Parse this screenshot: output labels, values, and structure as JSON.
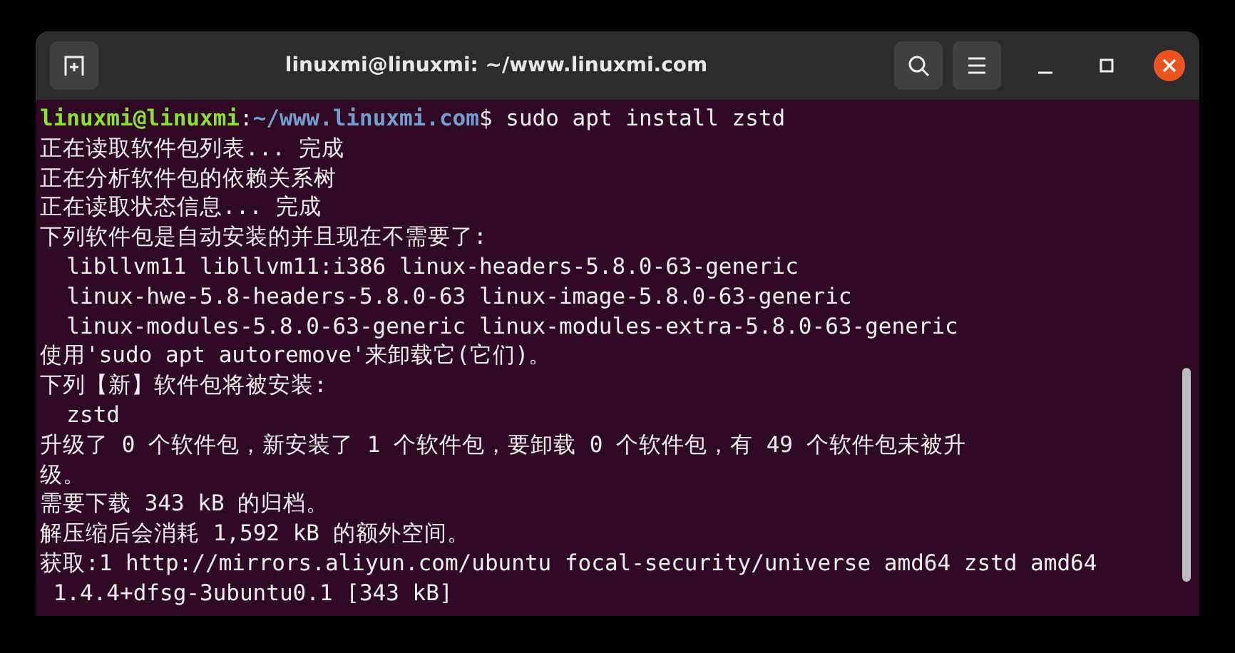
{
  "window": {
    "title": "linuxmi@linuxmi: ~/www.linuxmi.com"
  },
  "prompt": {
    "user_host": "linuxmi@linuxmi",
    "separator": ":",
    "path": "~/www.linuxmi.com",
    "command": "$ sudo apt install zstd"
  },
  "output": [
    "正在读取软件包列表... 完成",
    "正在分析软件包的依赖关系树",
    "正在读取状态信息... 完成",
    "下列软件包是自动安装的并且现在不需要了:",
    "  libllvm11 libllvm11:i386 linux-headers-5.8.0-63-generic",
    "  linux-hwe-5.8-headers-5.8.0-63 linux-image-5.8.0-63-generic",
    "  linux-modules-5.8.0-63-generic linux-modules-extra-5.8.0-63-generic",
    "使用'sudo apt autoremove'来卸载它(它们)。",
    "下列【新】软件包将被安装:",
    "  zstd",
    "升级了 0 个软件包，新安装了 1 个软件包，要卸载 0 个软件包，有 49 个软件包未被升",
    "级。",
    "需要下载 343 kB 的归档。",
    "解压缩后会消耗 1,592 kB 的额外空间。",
    "获取:1 http://mirrors.aliyun.com/ubuntu focal-security/universe amd64 zstd amd64",
    " 1.4.4+dfsg-3ubuntu0.1 [343 kB]"
  ]
}
